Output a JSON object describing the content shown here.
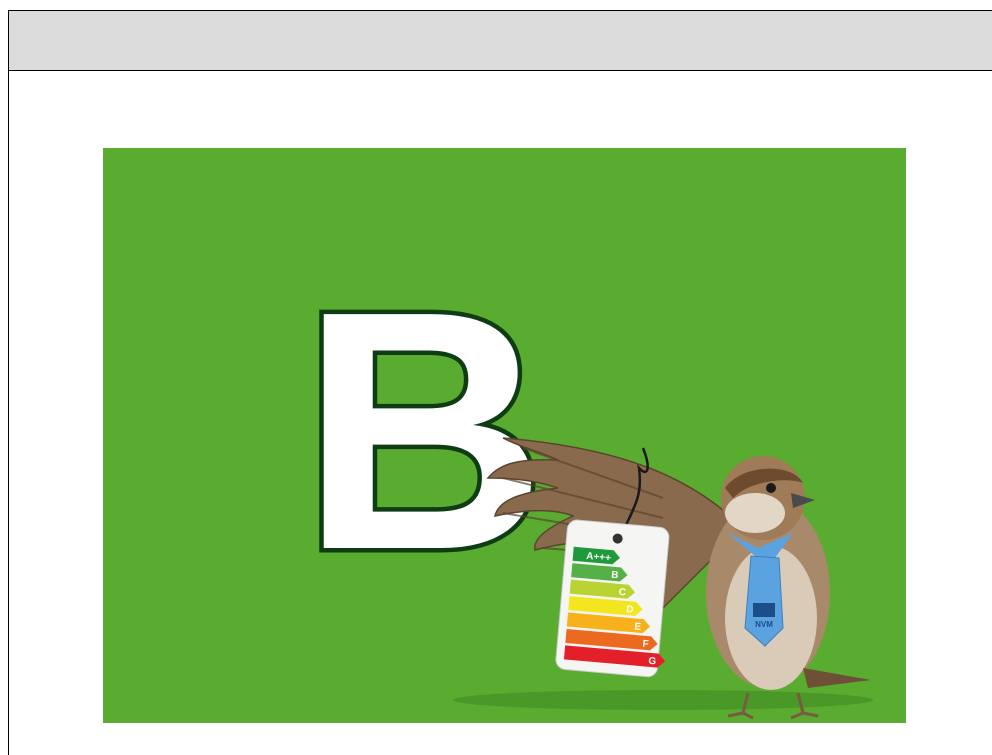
{
  "header": {
    "title": ""
  },
  "illustration": {
    "big_letter": "B",
    "label_ratings": [
      "A+++",
      "B",
      "C",
      "D",
      "E",
      "F",
      "G"
    ],
    "tie_logo_text": "NVM",
    "background_color": "#5aac31",
    "label_colors": [
      "#1f9a3a",
      "#54b047",
      "#b9d333",
      "#f3e61f",
      "#f7b21b",
      "#ec6a1f",
      "#e3202a"
    ]
  }
}
